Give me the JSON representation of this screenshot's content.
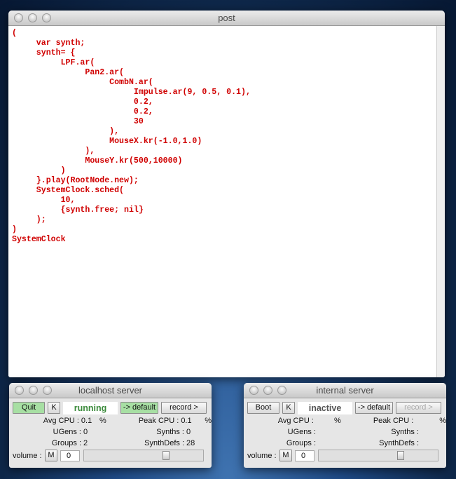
{
  "post": {
    "title": "post",
    "lines": [
      "(",
      "     var synth;",
      "     synth= {",
      "          LPF.ar(",
      "               Pan2.ar(",
      "                    CombN.ar(",
      "                         Impulse.ar(9, 0.5, 0.1),",
      "                         0.2,",
      "                         0.2,",
      "                         30",
      "                    ),",
      "                    MouseX.kr(-1.0,1.0)",
      "               ),",
      "               MouseY.kr(500,10000)",
      "          )",
      "     }.play(RootNode.new);",
      "     SystemClock.sched(",
      "          10,",
      "          {synth.free; nil}",
      "     );",
      ")"
    ],
    "output": "SystemClock"
  },
  "localhost": {
    "title": "localhost server",
    "boot": "Quit",
    "kill": "K",
    "status": "running",
    "default": "-> default",
    "record": "record >",
    "avg_cpu_label": "Avg CPU :",
    "avg_cpu": "0.1",
    "pct": "%",
    "peak_cpu_label": "Peak CPU :",
    "peak_cpu": "0.1",
    "ugens_label": "UGens :",
    "ugens": "0",
    "synths_label": "Synths :",
    "synths": "0",
    "groups_label": "Groups :",
    "groups": "2",
    "synthdefs_label": "SynthDefs :",
    "synthdefs": "28",
    "volume_label": "volume :",
    "mute": "M",
    "volume": "0",
    "status_color": "#3a8a3a"
  },
  "internal": {
    "title": "internal server",
    "boot": "Boot",
    "kill": "K",
    "status": "inactive",
    "default": "-> default",
    "record": "record >",
    "avg_cpu_label": "Avg CPU :",
    "avg_cpu": "",
    "pct": "%",
    "peak_cpu_label": "Peak CPU :",
    "peak_cpu": "",
    "ugens_label": "UGens :",
    "ugens": "",
    "synths_label": "Synths :",
    "synths": "",
    "groups_label": "Groups :",
    "groups": "",
    "synthdefs_label": "SynthDefs :",
    "synthdefs": "",
    "volume_label": "volume :",
    "mute": "M",
    "volume": "0",
    "status_color": "#555555"
  }
}
